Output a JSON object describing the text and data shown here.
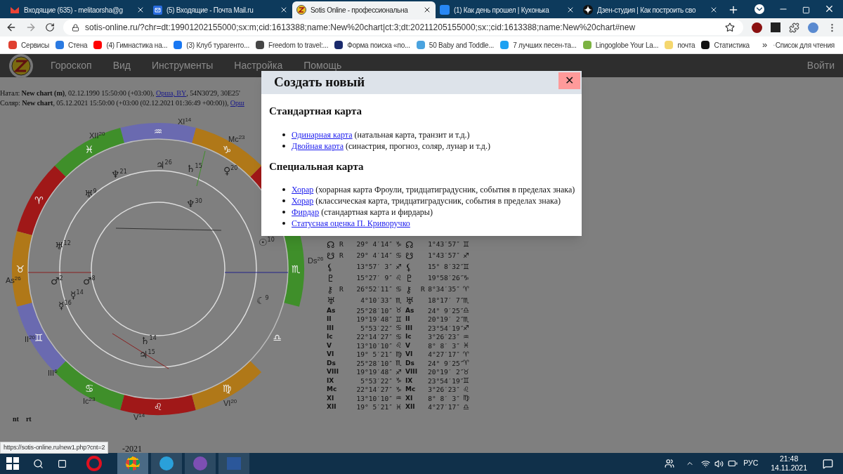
{
  "browser": {
    "tabs": [
      {
        "title": "Входящие (635) - melitaorsha@g",
        "kind": "gmail",
        "selected": false
      },
      {
        "title": "(5) Входящие - Почта Mail.ru",
        "kind": "mail",
        "selected": false
      },
      {
        "title": "Sotis Online - профессиональна",
        "kind": "sotis",
        "selected": true
      },
      {
        "title": "(1) Как день прошел | Кухонька",
        "kind": "vk",
        "selected": false
      },
      {
        "title": "Дзен-студия | Как построить сво",
        "kind": "dzen",
        "selected": false
      }
    ],
    "url": "sotis-online.ru/?chr=dt:19901202155000;sx:m;cid:1613388;name:New%20chart|ct:3;dt:20211205155000;sx:;cid:1613388;name:New%20chart#new",
    "bookmarks": [
      {
        "label": "Сервисы",
        "color": "#e04030"
      },
      {
        "label": "Стена",
        "color": "#2a7ae2"
      },
      {
        "label": "(4) Гимнастика на...",
        "color": "#ff0000"
      },
      {
        "label": "(3) Клуб турагенто...",
        "color": "#1877f2"
      },
      {
        "label": "Freedom to travel:...",
        "color": "#464646"
      },
      {
        "label": "Форма поиска «по...",
        "color": "#1a2a6c"
      },
      {
        "label": "50 Baby and Toddle...",
        "color": "#4aa3df"
      },
      {
        "label": "7 лучших песен-та...",
        "color": "#1da1f2"
      },
      {
        "label": "Lingoglobe Your La...",
        "color": "#7cb342"
      },
      {
        "label": "почта",
        "color": "#f5d76e"
      },
      {
        "label": "Статистика",
        "color": "#111111"
      }
    ],
    "more": "»",
    "reading_list": "Список для чтения"
  },
  "site": {
    "menu": [
      "Гороскоп",
      "Вид",
      "Инструменты",
      "Настройка",
      "Помощь"
    ],
    "login": "Войти",
    "info": [
      {
        "prefix": "Натал: **New chart (m)**, 02.12.1990 15:50:00 (+03:00), ",
        "link": "Орша, BY",
        "suffix": ", 54N30'29, 30E25'"
      },
      {
        "prefix": "Соляр: **New chart**, 05.12.2021 15:50:00 (+03:00 (02.12.2021 01:36:49 +00:00)), ",
        "link": "Орш"
      }
    ],
    "wheel": {
      "signs": [
        "♏",
        "♑",
        "♒",
        "♓",
        "♈",
        "♉",
        "♊",
        "♋",
        "♌",
        "♍",
        "♎"
      ],
      "houses": [
        {
          "label": "XI",
          "deg": "14"
        },
        {
          "label": "Mc",
          "deg": "23"
        },
        {
          "label": "XII",
          "deg": "20"
        },
        {
          "label": "As",
          "deg": "26"
        },
        {
          "label": "II",
          "deg": "20"
        },
        {
          "label": "III",
          "deg": "6"
        },
        {
          "label": "Ic",
          "deg": "23"
        },
        {
          "label": "V",
          "deg": "14"
        },
        {
          "label": "VI",
          "deg": "20"
        },
        {
          "label": "Ds",
          "deg": "26"
        }
      ],
      "planets": [
        {
          "glyph": "♆",
          "deg": "21"
        },
        {
          "glyph": "♃",
          "deg": "26"
        },
        {
          "glyph": "♄",
          "deg": "15"
        },
        {
          "glyph": "♀",
          "deg": "20"
        },
        {
          "glyph": "♅",
          "deg": "9"
        },
        {
          "glyph": "♅",
          "deg": "12"
        },
        {
          "glyph": "♂",
          "deg": "2"
        },
        {
          "glyph": "♂",
          "deg": "8"
        },
        {
          "glyph": "☿",
          "deg": "16"
        },
        {
          "glyph": "☿",
          "deg": "14"
        },
        {
          "glyph": "♄",
          "deg": "14"
        },
        {
          "glyph": "♆",
          "deg": "30"
        },
        {
          "glyph": "☉",
          "deg": "10"
        },
        {
          "glyph": "☾",
          "deg": "9"
        },
        {
          "glyph": "♃",
          "deg": "15"
        }
      ]
    },
    "footer": [
      "nt",
      "rt",
      "-2021"
    ],
    "table": [
      {
        "g1": "☊",
        "r1": "R",
        "p1": "29° 4′14″",
        "s1": "♑",
        "g2": "☊",
        "p2": "1°43′57″",
        "s2": "♊"
      },
      {
        "g1": "☋",
        "r1": "R",
        "p1": "29° 4′14″",
        "s1": "♋",
        "g2": "☋",
        "p2": "1°43′57″",
        "s2": "♐"
      },
      {
        "g1": "⚸",
        "p1": "13°57′ 3″",
        "s1": "♐",
        "g2": "⚸",
        "p2": "15° 8′32″",
        "s2": "♊"
      },
      {
        "g1": "♇",
        "p1": "15°27′ 9″",
        "s1": "♌",
        "g2": "♇",
        "p2": "19°58′26″",
        "s2": "♑"
      },
      {
        "g1": "⚷",
        "r1": "R",
        "p1": "26°52′11″",
        "s1": "♋",
        "g2": "⚷",
        "r2": "R",
        "p2": "8°34′35″",
        "s2": "♈"
      },
      {
        "g1": "♅",
        "p1": "4°10′33″",
        "s1": "♏",
        "g2": "♅",
        "p2": "18°17′ 7″",
        "s2": "♏"
      },
      {
        "g1": "As",
        "p1": "25°28′10″",
        "s1": "♉",
        "g2": "As",
        "p2": "24° 9′25″",
        "s2": "♎"
      },
      {
        "g1": "II",
        "p1": "19°19′48″",
        "s1": "♊",
        "g2": "II",
        "p2": "20°19′ 2″",
        "s2": "♏"
      },
      {
        "g1": "III",
        "p1": "5°53′22″",
        "s1": "♋",
        "g2": "III",
        "p2": "23°54′19″",
        "s2": "♐"
      },
      {
        "g1": "Ic",
        "p1": "22°14′27″",
        "s1": "♋",
        "g2": "Ic",
        "p2": "3°26′23″",
        "s2": "♒"
      },
      {
        "g1": "V",
        "p1": "13°10′10″",
        "s1": "♌",
        "g2": "V",
        "p2": "8° 8′ 3″",
        "s2": "♓"
      },
      {
        "g1": "VI",
        "p1": "19° 5′21″",
        "s1": "♍",
        "g2": "VI",
        "p2": "4°27′17″",
        "s2": "♈"
      },
      {
        "g1": "Ds",
        "p1": "25°28′10″",
        "s1": "♏",
        "g2": "Ds",
        "p2": "24° 9′25″",
        "s2": "♈"
      },
      {
        "g1": "VIII",
        "p1": "19°19′48″",
        "s1": "♐",
        "g2": "VIII",
        "p2": "20°19′ 2″",
        "s2": "♉"
      },
      {
        "g1": "IX",
        "p1": "5°53′22″",
        "s1": "♑",
        "g2": "IX",
        "p2": "23°54′19″",
        "s2": "♊"
      },
      {
        "g1": "Mc",
        "p1": "22°14′27″",
        "s1": "♑",
        "g2": "Mc",
        "p2": "3°26′23″",
        "s2": "♌"
      },
      {
        "g1": "XI",
        "p1": "13°10′10″",
        "s1": "♒",
        "g2": "XI",
        "p2": "8° 8′ 3″",
        "s2": "♍"
      },
      {
        "g1": "XII",
        "p1": "19° 5′21″",
        "s1": "♓",
        "g2": "XII",
        "p2": "4°27′17″",
        "s2": "♎"
      }
    ]
  },
  "dialog": {
    "title": "Создать новый",
    "close": "✕",
    "sections": [
      {
        "heading": "Стандартная карта",
        "items": [
          {
            "link": "Одинарная карта",
            "note": " (натальная карта, транзит и т.д.)"
          },
          {
            "link": "Двойная карта",
            "note": " (синастрия, прогноз, соляр, лунар и т.д.)"
          }
        ]
      },
      {
        "heading": "Специальная карта",
        "items": [
          {
            "link": "Хорар",
            "note": " (хорарная карта Фроули, тридцатиградусник, события в пределах знака)"
          },
          {
            "link": "Хорар",
            "note": " (классическая карта, тридцатиградусник, события в пределах знака)"
          },
          {
            "link": "Фирдар",
            "note": " (стандартная карта и фирдары)"
          },
          {
            "link": "Статусная оценка П. Криворучко"
          }
        ]
      }
    ]
  },
  "status_url": "https://sotis-online.ru/new1.php?cnt=2",
  "taskbar": {
    "lang": "РУС",
    "time": "21:48",
    "date": "14.11.2021"
  }
}
